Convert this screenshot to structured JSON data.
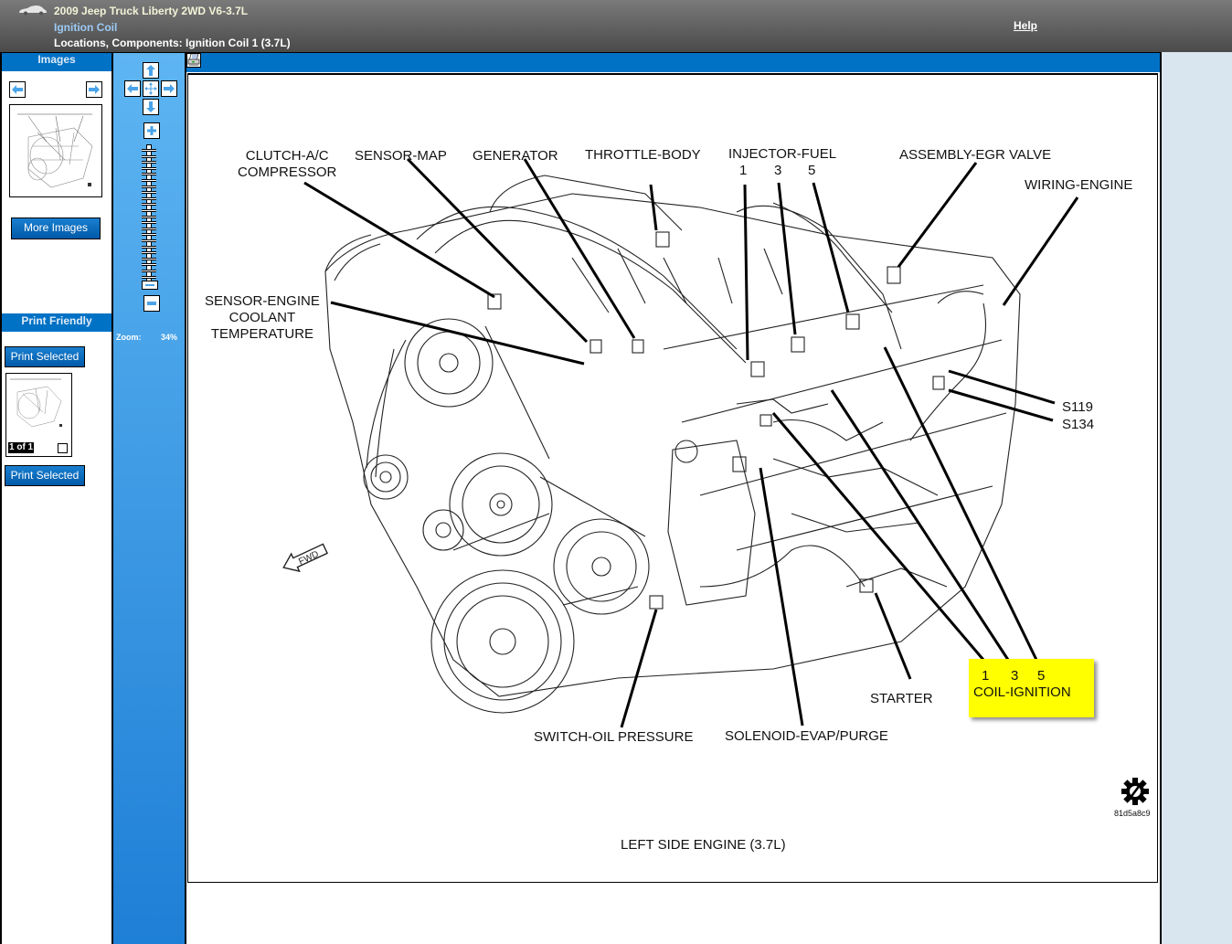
{
  "header": {
    "vehicle": "2009 Jeep Truck Liberty 2WD V6-3.7L",
    "component": "Ignition Coil",
    "breadcrumb": "Locations, Components: Ignition Coil 1 (3.7L)",
    "help_link": "Help",
    "car_icon": "car-icon"
  },
  "left_panel": {
    "images_heading": "Images",
    "prev_icon": "arrow-left-icon",
    "next_icon": "arrow-right-icon",
    "more_images_button": "More Images",
    "print_friendly_heading": "Print Friendly",
    "print_selected_top": "Print Selected",
    "print_selected_bottom": "Print Selected",
    "page_indicator": "1 of 1",
    "page_checkbox_checked": false
  },
  "zoom_toolbar": {
    "zoom_label": "Zoom:",
    "zoom_value": "34%",
    "zoom_level_percent": 34,
    "pan_icons": [
      "pan-up-icon",
      "pan-left-icon",
      "pan-center-icon",
      "pan-right-icon",
      "pan-down-icon"
    ],
    "zoom_in_icon": "plus-icon",
    "zoom_out_icon": "minus-icon"
  },
  "viewer": {
    "print_icon": "printer-icon",
    "diagram": {
      "labels": {
        "clutch": "CLUTCH-A/C\nCOMPRESSOR",
        "clutch_l1": "CLUTCH-A/C",
        "clutch_l2": "COMPRESSOR",
        "sensor_map": "SENSOR-MAP",
        "generator": "GENERATOR",
        "throttle": "THROTTLE-BODY",
        "injector": "INJECTOR-FUEL",
        "injector_nums": [
          "1",
          "3",
          "5"
        ],
        "egr": "ASSEMBLY-EGR VALVE",
        "wiring": "WIRING-ENGINE",
        "coolant_l1": "SENSOR-ENGINE",
        "coolant_l2": "COOLANT",
        "coolant_l3": "TEMPERATURE",
        "s119": "S119",
        "s134": "S134",
        "starter": "STARTER",
        "coil_nums": [
          "1",
          "3",
          "5"
        ],
        "coil": "COIL-IGNITION",
        "oil_switch": "SWITCH-OIL PRESSURE",
        "solenoid": "SOLENOID-EVAP/PURGE",
        "fwd": "FWD"
      },
      "caption": "LEFT SIDE ENGINE  (3.7L)",
      "image_code": "81d5a8c9",
      "highlight_color": "#ffff00"
    }
  },
  "colors": {
    "header_text": "#f3f3d8",
    "link_blue": "#9ccaf5",
    "panel_blue": "#0072c6",
    "toolbar_blue": "#3c9be6",
    "side_fill": "#d9e5ef"
  }
}
